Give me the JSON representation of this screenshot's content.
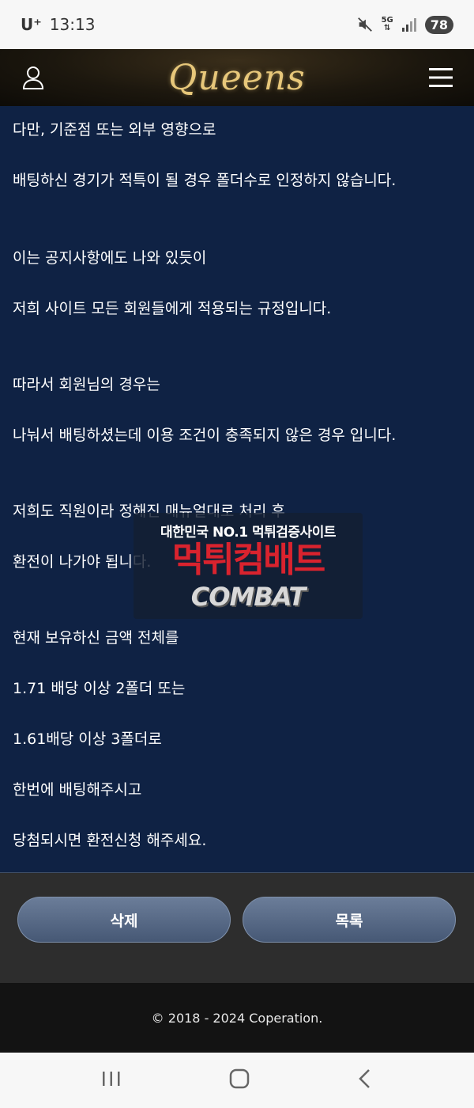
{
  "status_bar": {
    "carrier": "U⁺",
    "time": "13:13",
    "network": "5G",
    "battery": "78"
  },
  "header": {
    "logo_text": "Queens"
  },
  "content": {
    "lines": [
      "다만, 기준점 또는 외부 영향으로",
      "배팅하신 경기가 적특이 될 경우 폴더수로 인정하지 않습니다.",
      "이는 공지사항에도 나와 있듯이",
      "저희 사이트 모든 회원들에게 적용되는 규정입니다.",
      "따라서 회원님의 경우는",
      "나눠서 배팅하셨는데 이용 조건이 충족되지 않은 경우 입니다.",
      "저희도 직원이라 정해진 매뉴얼대로 처리 후",
      "환전이 나가야 됩니다.",
      "현재 보유하신 금액 전체를",
      "1.71 배당 이상 2폴더 또는",
      "1.61배당 이상 3폴더로",
      "한번에 배팅해주시고",
      "당첨되시면 환전신청 해주세요."
    ]
  },
  "watermark": {
    "top": "대한민국 NO.1 먹튀검증사이트",
    "middle": "먹튀컴배트",
    "bottom": "COMBAT"
  },
  "actions": {
    "delete_label": "삭제",
    "list_label": "목록"
  },
  "footer": {
    "copyright": "© 2018 - 2024 Coperation."
  },
  "icons": {
    "user": "user-icon",
    "menu": "hamburger-menu-icon",
    "mute": "mute-icon",
    "signal": "signal-icon"
  }
}
